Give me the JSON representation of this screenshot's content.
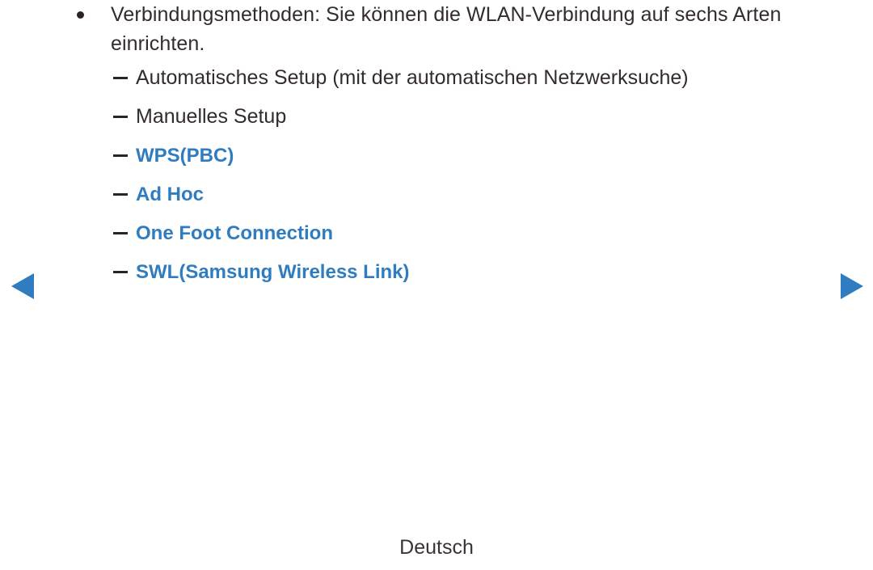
{
  "page": {
    "background_color": "#ffffff",
    "text_color": "#332b2e",
    "accent_color": "#2f7dc0"
  },
  "nav": {
    "prev_label": "◀",
    "next_label": "▶"
  },
  "content": {
    "bullet": {
      "marker": "•",
      "text": "Verbindungsmethoden: Sie können die WLAN-Verbindung auf sechs Arten einrichten."
    },
    "sub_items": [
      {
        "marker": "–",
        "label": "Automatisches Setup (mit der automatischen Netzwerksuche)",
        "highlighted": false
      },
      {
        "marker": "–",
        "label": "Manuelles Setup",
        "highlighted": false
      },
      {
        "marker": "–",
        "label": "WPS(PBC)",
        "highlighted": true
      },
      {
        "marker": "–",
        "label": "Ad Hoc",
        "highlighted": true
      },
      {
        "marker": "–",
        "label": "One Foot Connection",
        "highlighted": true
      },
      {
        "marker": "–",
        "label": "SWL(Samsung Wireless Link)",
        "highlighted": true
      }
    ]
  },
  "footer": {
    "language": "Deutsch"
  }
}
